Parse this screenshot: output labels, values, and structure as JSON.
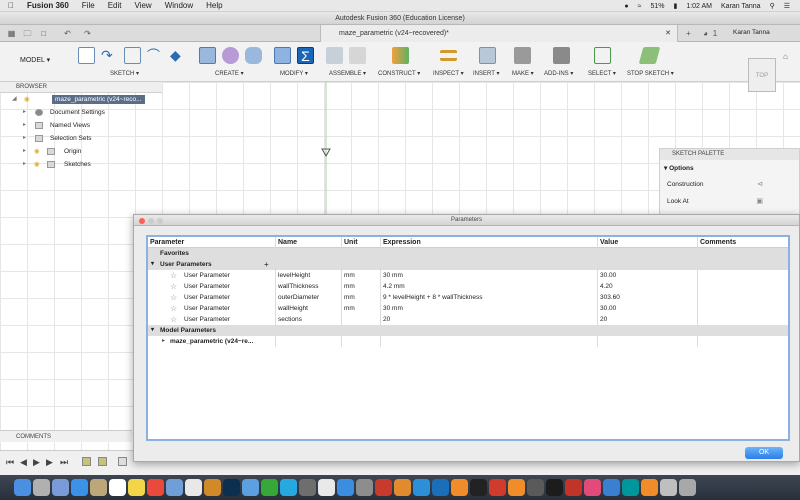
{
  "menubar": {
    "app": "Fusion 360",
    "items": [
      "File",
      "Edit",
      "View",
      "Window",
      "Help"
    ],
    "battery": "51%",
    "time": "1:02 AM",
    "user": "Karan Tanna"
  },
  "window": {
    "title": "Autodesk Fusion 360 (Education License)",
    "doc_tab": "maze_parametric (v24~recovered)*",
    "notifications": "1",
    "user": "Karan Tanna"
  },
  "toolbar": {
    "workspace": "MODEL",
    "groups": [
      "SKETCH",
      "CREATE",
      "MODIFY",
      "ASSEMBLE",
      "CONSTRUCT",
      "INSPECT",
      "INSERT",
      "MAKE",
      "ADD-INS",
      "SELECT",
      "STOP SKETCH"
    ]
  },
  "browser": {
    "header": "BROWSER",
    "root": "maze_parametric (v24~reco...",
    "items": [
      "Document Settings",
      "Named Views",
      "Selection Sets",
      "Origin",
      "Sketches"
    ]
  },
  "viewcube": {
    "label": "TOP"
  },
  "palette": {
    "header": "SKETCH PALETTE",
    "options_label": "Options",
    "rows": [
      "Construction",
      "Look At"
    ]
  },
  "comments": {
    "label": "COMMENTS"
  },
  "dialog": {
    "title": "Parameters",
    "headers": [
      "Parameter",
      "Name",
      "Unit",
      "Expression",
      "Value",
      "Comments"
    ],
    "favorites": "Favorites",
    "user_group": "User Parameters",
    "add_symbol": "+",
    "rows": [
      {
        "param": "User Parameter",
        "name": "levelHeight",
        "unit": "mm",
        "expr": "30 mm",
        "value": "30.00"
      },
      {
        "param": "User Parameter",
        "name": "wallThickness",
        "unit": "mm",
        "expr": "4.2 mm",
        "value": "4.20"
      },
      {
        "param": "User Parameter",
        "name": "outerDiameter",
        "unit": "mm",
        "expr": "9 * levelHeight + 8 * wallThickness",
        "value": "303.60"
      },
      {
        "param": "User Parameter",
        "name": "wallHeight",
        "unit": "mm",
        "expr": "30 mm",
        "value": "30.00"
      },
      {
        "param": "User Parameter",
        "name": "sections",
        "unit": "",
        "expr": "20",
        "value": "20"
      }
    ],
    "model_group": "Model Parameters",
    "model_item": "maze_parametric (v24~re...",
    "ok": "OK"
  },
  "colors": {
    "accent": "#2a7fe8",
    "selection": "#5a6e8a",
    "sketch_fill": "#f7d9bd"
  }
}
